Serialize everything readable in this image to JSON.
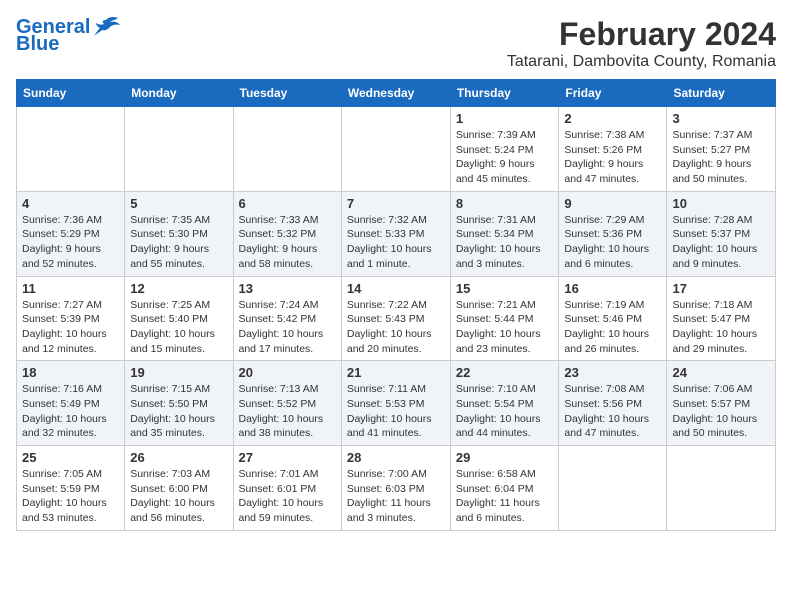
{
  "header": {
    "logo_line1": "General",
    "logo_line2": "Blue",
    "title": "February 2024",
    "subtitle": "Tatarani, Dambovita County, Romania"
  },
  "days_of_week": [
    "Sunday",
    "Monday",
    "Tuesday",
    "Wednesday",
    "Thursday",
    "Friday",
    "Saturday"
  ],
  "weeks": [
    [
      {
        "day": "",
        "info": ""
      },
      {
        "day": "",
        "info": ""
      },
      {
        "day": "",
        "info": ""
      },
      {
        "day": "",
        "info": ""
      },
      {
        "day": "1",
        "info": "Sunrise: 7:39 AM\nSunset: 5:24 PM\nDaylight: 9 hours\nand 45 minutes."
      },
      {
        "day": "2",
        "info": "Sunrise: 7:38 AM\nSunset: 5:26 PM\nDaylight: 9 hours\nand 47 minutes."
      },
      {
        "day": "3",
        "info": "Sunrise: 7:37 AM\nSunset: 5:27 PM\nDaylight: 9 hours\nand 50 minutes."
      }
    ],
    [
      {
        "day": "4",
        "info": "Sunrise: 7:36 AM\nSunset: 5:29 PM\nDaylight: 9 hours\nand 52 minutes."
      },
      {
        "day": "5",
        "info": "Sunrise: 7:35 AM\nSunset: 5:30 PM\nDaylight: 9 hours\nand 55 minutes."
      },
      {
        "day": "6",
        "info": "Sunrise: 7:33 AM\nSunset: 5:32 PM\nDaylight: 9 hours\nand 58 minutes."
      },
      {
        "day": "7",
        "info": "Sunrise: 7:32 AM\nSunset: 5:33 PM\nDaylight: 10 hours\nand 1 minute."
      },
      {
        "day": "8",
        "info": "Sunrise: 7:31 AM\nSunset: 5:34 PM\nDaylight: 10 hours\nand 3 minutes."
      },
      {
        "day": "9",
        "info": "Sunrise: 7:29 AM\nSunset: 5:36 PM\nDaylight: 10 hours\nand 6 minutes."
      },
      {
        "day": "10",
        "info": "Sunrise: 7:28 AM\nSunset: 5:37 PM\nDaylight: 10 hours\nand 9 minutes."
      }
    ],
    [
      {
        "day": "11",
        "info": "Sunrise: 7:27 AM\nSunset: 5:39 PM\nDaylight: 10 hours\nand 12 minutes."
      },
      {
        "day": "12",
        "info": "Sunrise: 7:25 AM\nSunset: 5:40 PM\nDaylight: 10 hours\nand 15 minutes."
      },
      {
        "day": "13",
        "info": "Sunrise: 7:24 AM\nSunset: 5:42 PM\nDaylight: 10 hours\nand 17 minutes."
      },
      {
        "day": "14",
        "info": "Sunrise: 7:22 AM\nSunset: 5:43 PM\nDaylight: 10 hours\nand 20 minutes."
      },
      {
        "day": "15",
        "info": "Sunrise: 7:21 AM\nSunset: 5:44 PM\nDaylight: 10 hours\nand 23 minutes."
      },
      {
        "day": "16",
        "info": "Sunrise: 7:19 AM\nSunset: 5:46 PM\nDaylight: 10 hours\nand 26 minutes."
      },
      {
        "day": "17",
        "info": "Sunrise: 7:18 AM\nSunset: 5:47 PM\nDaylight: 10 hours\nand 29 minutes."
      }
    ],
    [
      {
        "day": "18",
        "info": "Sunrise: 7:16 AM\nSunset: 5:49 PM\nDaylight: 10 hours\nand 32 minutes."
      },
      {
        "day": "19",
        "info": "Sunrise: 7:15 AM\nSunset: 5:50 PM\nDaylight: 10 hours\nand 35 minutes."
      },
      {
        "day": "20",
        "info": "Sunrise: 7:13 AM\nSunset: 5:52 PM\nDaylight: 10 hours\nand 38 minutes."
      },
      {
        "day": "21",
        "info": "Sunrise: 7:11 AM\nSunset: 5:53 PM\nDaylight: 10 hours\nand 41 minutes."
      },
      {
        "day": "22",
        "info": "Sunrise: 7:10 AM\nSunset: 5:54 PM\nDaylight: 10 hours\nand 44 minutes."
      },
      {
        "day": "23",
        "info": "Sunrise: 7:08 AM\nSunset: 5:56 PM\nDaylight: 10 hours\nand 47 minutes."
      },
      {
        "day": "24",
        "info": "Sunrise: 7:06 AM\nSunset: 5:57 PM\nDaylight: 10 hours\nand 50 minutes."
      }
    ],
    [
      {
        "day": "25",
        "info": "Sunrise: 7:05 AM\nSunset: 5:59 PM\nDaylight: 10 hours\nand 53 minutes."
      },
      {
        "day": "26",
        "info": "Sunrise: 7:03 AM\nSunset: 6:00 PM\nDaylight: 10 hours\nand 56 minutes."
      },
      {
        "day": "27",
        "info": "Sunrise: 7:01 AM\nSunset: 6:01 PM\nDaylight: 10 hours\nand 59 minutes."
      },
      {
        "day": "28",
        "info": "Sunrise: 7:00 AM\nSunset: 6:03 PM\nDaylight: 11 hours\nand 3 minutes."
      },
      {
        "day": "29",
        "info": "Sunrise: 6:58 AM\nSunset: 6:04 PM\nDaylight: 11 hours\nand 6 minutes."
      },
      {
        "day": "",
        "info": ""
      },
      {
        "day": "",
        "info": ""
      }
    ]
  ]
}
